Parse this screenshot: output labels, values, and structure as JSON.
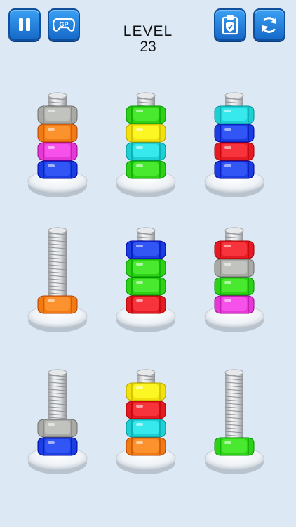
{
  "header": {
    "level_label": "LEVEL",
    "level_number": "23",
    "pause_icon": "pause-icon",
    "gamepad_icon": "gamepad-icon",
    "clipboard_icon": "clipboard-shield-icon",
    "restart_icon": "restart-arrows-icon"
  },
  "colors": {
    "gray": "#a9aaa6",
    "orange": "#f07a14",
    "magenta": "#e23ad2",
    "blue": "#1a3ee0",
    "green": "#30d017",
    "yellow": "#f1e10c",
    "cyan": "#1ecfd3",
    "red": "#e41b24"
  },
  "bolts": [
    {
      "nuts": [
        "blue",
        "magenta",
        "orange",
        "gray"
      ]
    },
    {
      "nuts": [
        "green",
        "cyan",
        "yellow",
        "green"
      ]
    },
    {
      "nuts": [
        "blue",
        "red",
        "blue",
        "cyan"
      ]
    },
    {
      "nuts": [
        "orange"
      ]
    },
    {
      "nuts": [
        "red",
        "green",
        "green",
        "blue"
      ]
    },
    {
      "nuts": [
        "magenta",
        "green",
        "gray",
        "red"
      ]
    },
    {
      "nuts": [
        "blue",
        "gray"
      ]
    },
    {
      "nuts": [
        "orange",
        "cyan",
        "red",
        "yellow"
      ]
    },
    {
      "nuts": [
        "green"
      ]
    }
  ]
}
